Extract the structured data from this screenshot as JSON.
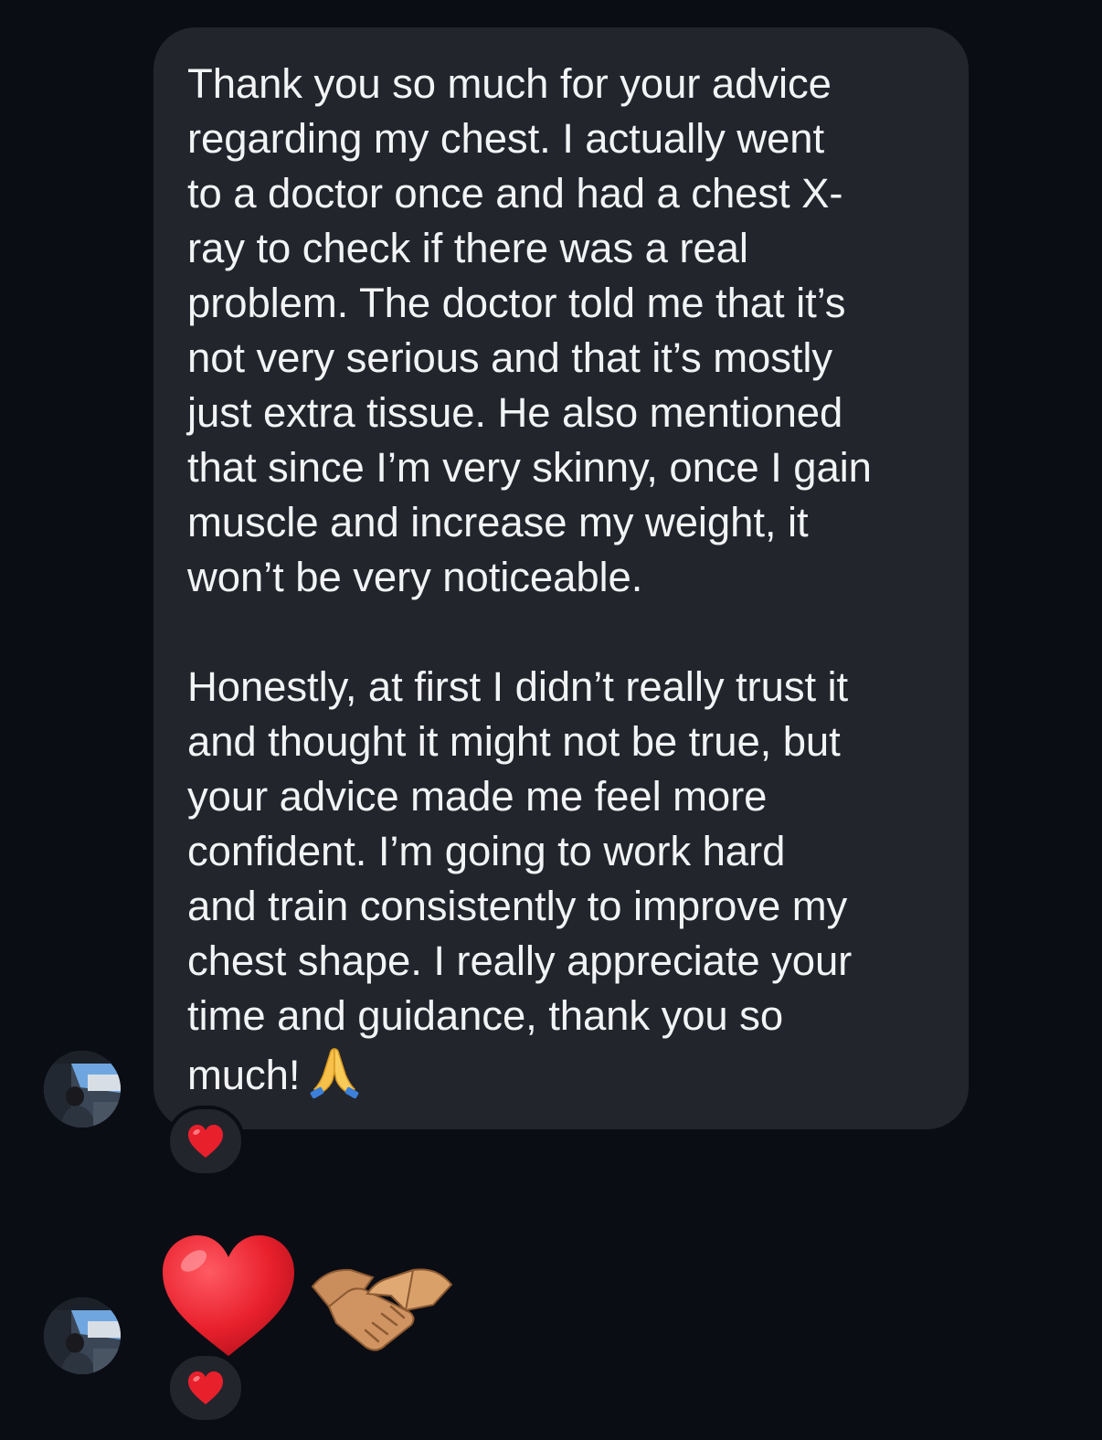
{
  "thread": {
    "message": {
      "paragraphs": [
        [
          "Thank you so much for your advice",
          "regarding my chest. I actually went",
          "to a doctor once and had a chest X-",
          "ray to check if there was a real",
          "problem. The doctor told me that it’s",
          "not very serious and that it’s mostly",
          "just extra tissue. He also mentioned",
          "that since I’m very skinny, once I gain",
          "muscle and increase my weight, it",
          "won’t be very noticeable."
        ],
        [
          "Honestly, at first I didn’t really trust it",
          "and thought it might not be true, but",
          "your advice made me feel more",
          "confident. I’m going to work hard",
          "and train consistently to improve my",
          "chest shape. I really appreciate your",
          "time and guidance, thank you so",
          "much!"
        ]
      ],
      "trailing_emoji": "folded-hands",
      "reaction": "red-heart"
    },
    "emoji_message": {
      "emojis": [
        "red-heart",
        "handshake"
      ],
      "reaction": "red-heart"
    }
  },
  "colors": {
    "background": "#0b0d14",
    "bubble": "#23252d",
    "text": "#f2f3f5",
    "heart": "#e8202c"
  }
}
